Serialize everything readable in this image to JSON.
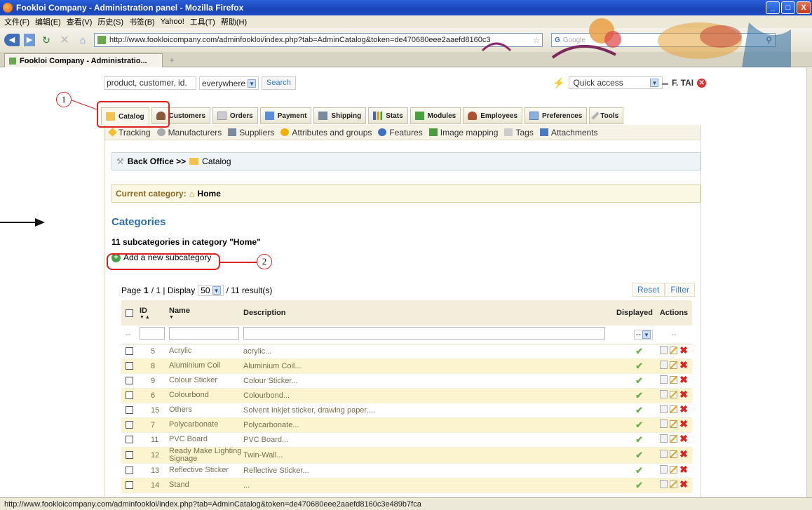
{
  "window": {
    "title": "Fookloi Company - Administration panel - Mozilla Firefox",
    "buttons": [
      "_",
      "□",
      "X"
    ]
  },
  "menubar": [
    "文件(F)",
    "编辑(E)",
    "查看(V)",
    "历史(S)",
    "书签(B)",
    "Yahoo!",
    "工具(T)",
    "帮助(H)"
  ],
  "navbar": {
    "url": "http://www.fookloicompany.com/adminfookloi/index.php?tab=AdminCatalog&token=de470680eee2aaefd8160c3",
    "search_placeholder": "Google"
  },
  "browser_tab": {
    "label": "Fookloi Company - Administratio...",
    "newtab": "+"
  },
  "admin": {
    "search_value": "product, customer, id.",
    "search_scope": "everywhere",
    "search_button": "Search",
    "quick_access": "Quick access",
    "user": "F. TAI",
    "tabs": [
      "Catalog",
      "Customers",
      "Orders",
      "Payment",
      "Shipping",
      "Stats",
      "Modules",
      "Employees",
      "Preferences",
      "Tools"
    ],
    "subnav": [
      "Tracking",
      "Manufacturers",
      "Suppliers",
      "Attributes and groups",
      "Features",
      "Image mapping",
      "Tags",
      "Attachments"
    ],
    "breadcrumb": {
      "first": "Back Office >>",
      "second": "Catalog"
    },
    "current_category_label": "Current category:",
    "current_category": "Home",
    "section_title": "Categories",
    "subcount": "11 subcategories in category \"Home\"",
    "add_link": "Add a new subcategory",
    "pager": {
      "page_label": "Page",
      "page": "1",
      "slash": "/ 1 | Display",
      "per_page": "50",
      "results": "/ 11 result(s)"
    },
    "reset": "Reset",
    "filter": "Filter",
    "table": {
      "headers": {
        "id": "ID",
        "name": "Name",
        "description": "Description",
        "displayed": "Displayed",
        "actions": "Actions"
      },
      "filter_dash": "--",
      "rows": [
        {
          "id": "5",
          "name": "Acrylic",
          "description": "acrylic...",
          "alt": false
        },
        {
          "id": "8",
          "name": "Aluminium Coil",
          "description": "Aluminium Coil...",
          "alt": true
        },
        {
          "id": "9",
          "name": "Colour Sticker",
          "description": "Colour Sticker...",
          "alt": false
        },
        {
          "id": "6",
          "name": "Colourbond",
          "description": "Colourbond...",
          "alt": true
        },
        {
          "id": "15",
          "name": "Others",
          "description": "Solvent Inkjet sticker, drawing paper....",
          "alt": false
        },
        {
          "id": "7",
          "name": "Polycarbonate",
          "description": "Polycarbonate...",
          "alt": true
        },
        {
          "id": "11",
          "name": "PVC Board",
          "description": "PVC Board...",
          "alt": false
        },
        {
          "id": "12",
          "name": "Ready Make Lighting Signage",
          "description": "Twin-Wall...",
          "alt": true
        },
        {
          "id": "13",
          "name": "Reflective Sticker",
          "description": "Reflective Sticker...",
          "alt": false
        },
        {
          "id": "14",
          "name": "Stand",
          "description": "...",
          "alt": true
        }
      ]
    }
  },
  "annotations": {
    "one": "1",
    "two": "2"
  },
  "status": "http://www.fookloicompany.com/adminfookloi/index.php?tab=AdminCatalog&token=de470680eee2aaefd8160c3e489b7fca",
  "colors": {
    "accent": "#2c70a8",
    "titlebar": "#1a45b8",
    "highlight_row": "#fbf4cf",
    "annotation": "#dd2222"
  }
}
